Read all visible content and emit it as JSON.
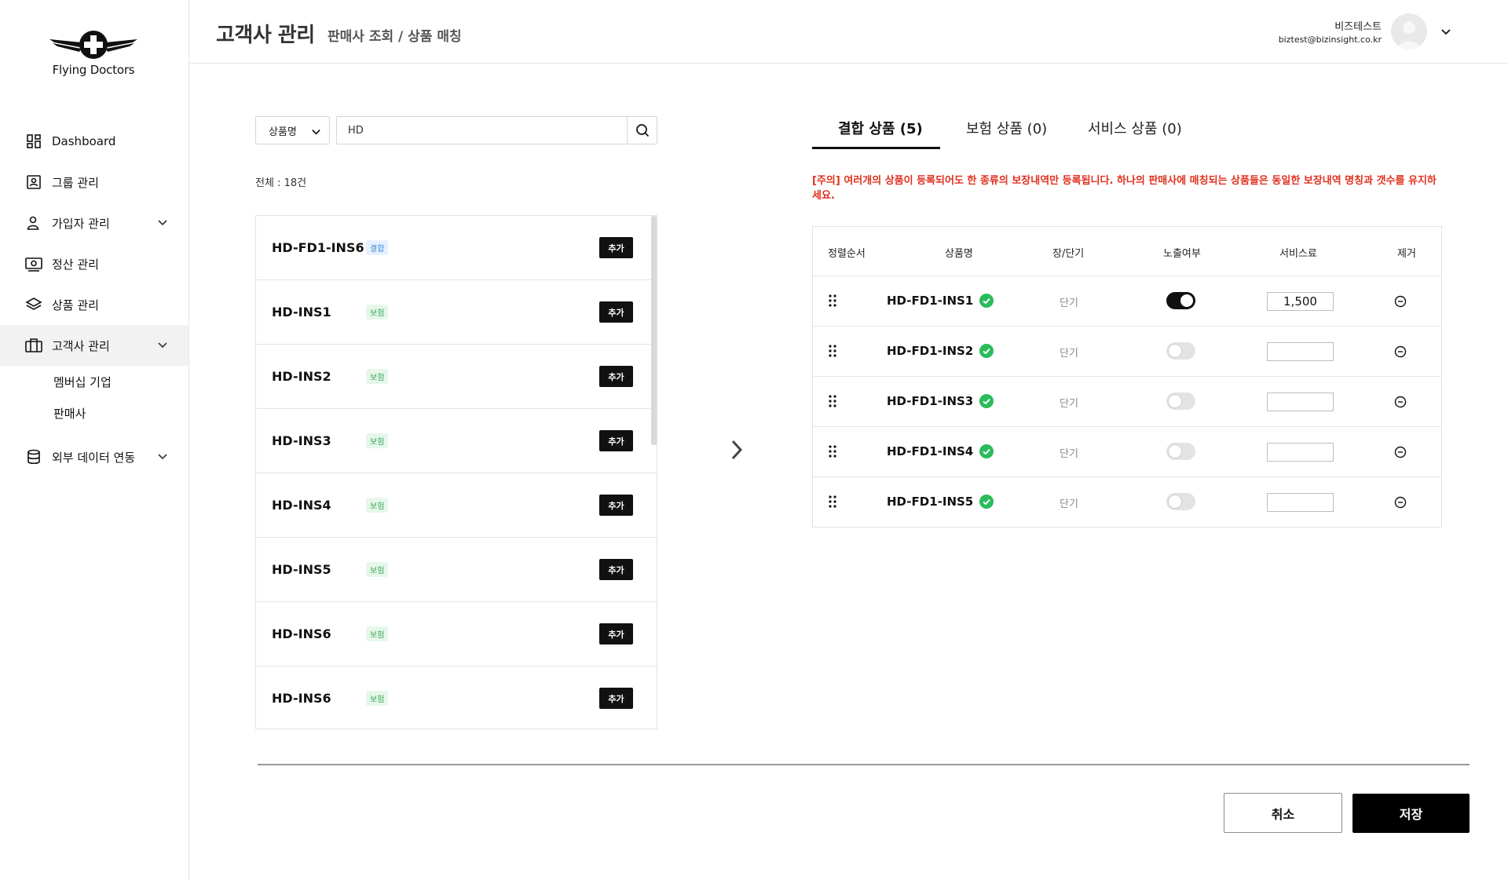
{
  "brand": {
    "name": "Flying Doctors"
  },
  "sidebar": {
    "items": [
      {
        "label": "Dashboard",
        "icon": "dashboard-icon"
      },
      {
        "label": "그룹 관리",
        "icon": "group-icon"
      },
      {
        "label": "가입자 관리",
        "icon": "user-icon"
      },
      {
        "label": "정산 관리",
        "icon": "money-icon"
      },
      {
        "label": "상품 관리",
        "icon": "layers-icon"
      },
      {
        "label": "고객사 관리",
        "icon": "briefcase-icon"
      },
      {
        "label": "외부 데이터 연동",
        "icon": "database-icon"
      }
    ],
    "sub_items": [
      {
        "label": "멤버십 기업"
      },
      {
        "label": "판매사"
      }
    ]
  },
  "header": {
    "title": "고객사 관리",
    "breadcrumb": "판매사 조회 / 상품 매칭",
    "user_name": "비즈테스트",
    "user_email": "biztest@bizinsight.co.kr"
  },
  "search": {
    "type_label": "상품명",
    "value": "HD",
    "total_label": "전체 : 18건"
  },
  "products": [
    {
      "name": "HD-FD1-INS6",
      "badge": "결합",
      "kind": "combo",
      "add_label": "추가"
    },
    {
      "name": "HD-INS1",
      "badge": "보험",
      "kind": "ins",
      "add_label": "추가"
    },
    {
      "name": "HD-INS2",
      "badge": "보험",
      "kind": "ins",
      "add_label": "추가"
    },
    {
      "name": "HD-INS3",
      "badge": "보험",
      "kind": "ins",
      "add_label": "추가"
    },
    {
      "name": "HD-INS4",
      "badge": "보험",
      "kind": "ins",
      "add_label": "추가"
    },
    {
      "name": "HD-INS5",
      "badge": "보험",
      "kind": "ins",
      "add_label": "추가"
    },
    {
      "name": "HD-INS6",
      "badge": "보험",
      "kind": "ins",
      "add_label": "추가"
    },
    {
      "name": "HD-INS6",
      "badge": "보험",
      "kind": "ins",
      "add_label": "추가"
    }
  ],
  "tabs": [
    {
      "label": "결합 상품 (5)",
      "active": true
    },
    {
      "label": "보험 상품 (0)",
      "active": false
    },
    {
      "label": "서비스 상품 (0)",
      "active": false
    }
  ],
  "warning": "[주의] 여러개의 상품이 등록되어도 한 종류의 보장내역만 등록됩니다. 하나의 판매사에 매칭되는 상품들은 동일한 보장내역 명칭과 갯수를 유지하세요.",
  "table": {
    "headers": {
      "order": "정렬순서",
      "name": "상품명",
      "term": "장/단기",
      "visible": "노출여부",
      "fee": "서비스료",
      "remove": "제거"
    },
    "rows": [
      {
        "name": "HD-FD1-INS1",
        "term": "단기",
        "visible": true,
        "fee": "1,500"
      },
      {
        "name": "HD-FD1-INS2",
        "term": "단기",
        "visible": false,
        "fee": ""
      },
      {
        "name": "HD-FD1-INS3",
        "term": "단기",
        "visible": false,
        "fee": ""
      },
      {
        "name": "HD-FD1-INS4",
        "term": "단기",
        "visible": false,
        "fee": ""
      },
      {
        "name": "HD-FD1-INS5",
        "term": "단기",
        "visible": false,
        "fee": ""
      }
    ]
  },
  "actions": {
    "cancel_label": "취소",
    "save_label": "저장"
  },
  "colors": {
    "warning": "#e0301e",
    "check": "#2bbb5b",
    "combo_badge": "#3a86e0",
    "ins_badge": "#39a85b"
  }
}
